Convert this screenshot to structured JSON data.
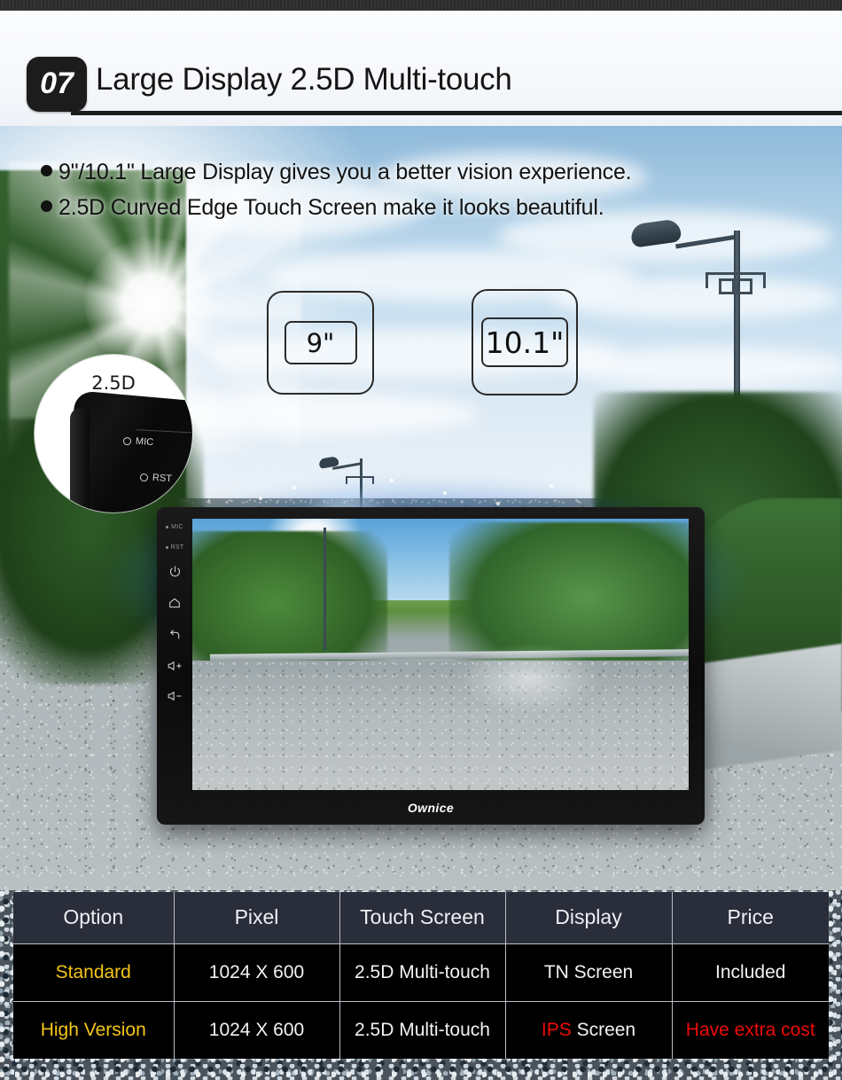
{
  "header": {
    "number": "07",
    "title": "Large Display 2.5D Multi-touch"
  },
  "bullets": [
    "9\"/10.1\" Large Display gives you a better vision experience.",
    "2.5D Curved Edge Touch Screen make it looks beautiful."
  ],
  "size_badges": [
    {
      "label": "9\""
    },
    {
      "label": "10.1\""
    }
  ],
  "callout": {
    "label": "2.5D",
    "keys": [
      {
        "label": "MIC"
      },
      {
        "label": "RST"
      }
    ]
  },
  "device": {
    "brand": "Ownice",
    "side_labels": [
      {
        "label": "MIC"
      },
      {
        "label": "RST"
      }
    ],
    "side_icons": [
      {
        "name": "power-icon",
        "glyph": "⏻"
      },
      {
        "name": "home-icon",
        "glyph": "⌂"
      },
      {
        "name": "back-icon",
        "glyph": "↩"
      },
      {
        "name": "volume-up-icon",
        "glyph": "◁+"
      },
      {
        "name": "volume-down-icon",
        "glyph": "◁-"
      }
    ]
  },
  "spec_table": {
    "headers": [
      "Option",
      "Pixel",
      "Touch Screen",
      "Display",
      "Price"
    ],
    "rows": [
      {
        "option": "Standard",
        "pixel": "1024 X 600",
        "touch_screen": "2.5D Multi-touch",
        "display_prefix": "TN",
        "display_suffix": " Screen",
        "price": "Included"
      },
      {
        "option": "High Version",
        "pixel": "1024 X 600",
        "touch_screen": "2.5D Multi-touch",
        "display_prefix": "IPS",
        "display_suffix": " Screen",
        "price": "Have extra cost"
      }
    ]
  },
  "colors": {
    "header_bg": "#2a2d3a",
    "row_bg": "#000000",
    "accent_yellow": "#f5c518",
    "accent_red": "#f00a0a",
    "text_white": "#f2f2f2"
  }
}
